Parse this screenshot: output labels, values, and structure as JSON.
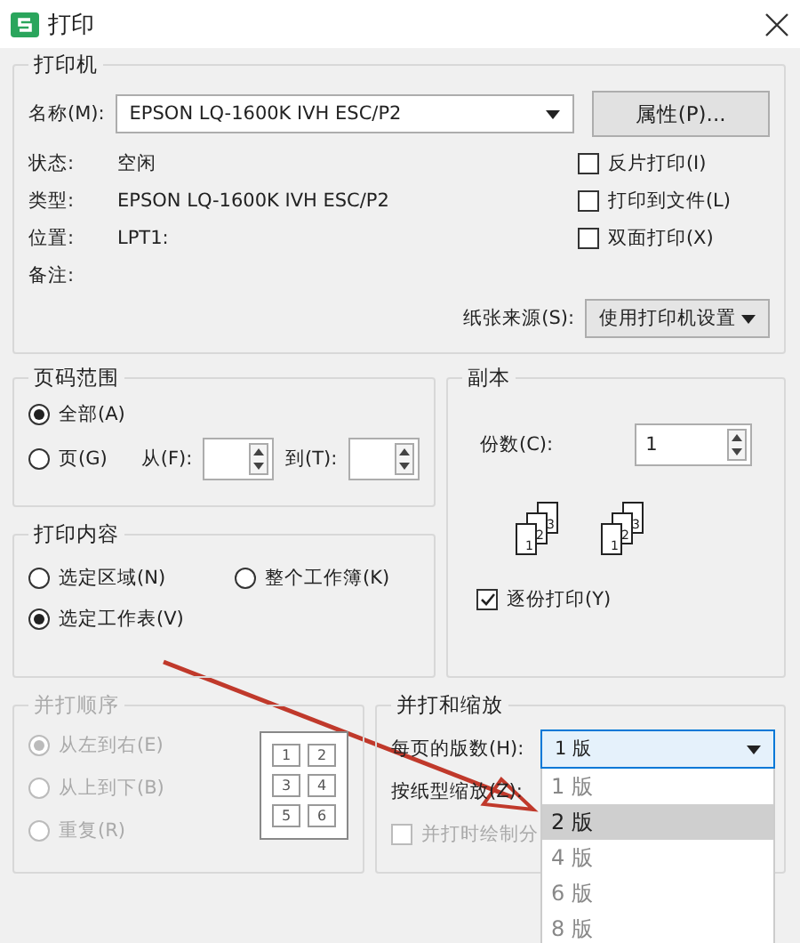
{
  "window": {
    "title": "打印"
  },
  "printer": {
    "title": "打印机",
    "name_label": "名称(M):",
    "name_value": "EPSON LQ-1600K IVH ESC/P2",
    "properties_button": "属性(P)...",
    "info": [
      {
        "label": "状态:",
        "value": "空闲"
      },
      {
        "label": "类型:",
        "value": "EPSON LQ-1600K IVH ESC/P2"
      },
      {
        "label": "位置:",
        "value": "LPT1:"
      },
      {
        "label": "备注:"
      }
    ],
    "options": [
      {
        "label": "反片打印(I)",
        "checked": false
      },
      {
        "label": "打印到文件(L)",
        "checked": false
      },
      {
        "label": "双面打印(X)",
        "checked": false
      }
    ],
    "paper_source_label": "纸张来源(S):",
    "paper_source_value": "使用打印机设置"
  },
  "page_range": {
    "title": "页码范围",
    "options": [
      {
        "label": "全部(A)",
        "selected": true
      },
      {
        "label": "页(G)",
        "selected": false
      }
    ],
    "from_label": "从(F):",
    "to_label": "到(T):"
  },
  "copies": {
    "title": "副本",
    "count_label": "份数(C):",
    "count_value": "1",
    "icons": [
      {
        "page_numbers": [
          "1",
          "2",
          "3"
        ]
      },
      {
        "page_numbers": [
          "1",
          "2",
          "3"
        ]
      }
    ],
    "collate": {
      "label": "逐份打印(Y)",
      "checked": true
    }
  },
  "print_content": {
    "title": "打印内容",
    "options": [
      {
        "label": "选定区域(N)",
        "selected": false
      },
      {
        "label": "整个工作簿(K)",
        "selected": false
      },
      {
        "label": "选定工作表(V)",
        "selected": true
      }
    ]
  },
  "order": {
    "title": "并打顺序",
    "disabled": true,
    "options": [
      {
        "label": "从左到右(E)",
        "selected": true
      },
      {
        "label": "从上到下(B)",
        "selected": false
      },
      {
        "label": "重复(R)",
        "selected": false
      }
    ],
    "grid_numbers": [
      "1",
      "2",
      "3",
      "4",
      "5",
      "6"
    ]
  },
  "scaling": {
    "title": "并打和缩放",
    "pages_per_sheet_label": "每页的版数(H):",
    "pages_per_sheet_value": "1 版",
    "scale_label": "按纸型缩放(Z):",
    "borders": {
      "label": "并打时绘制分",
      "checked": false,
      "disabled": true
    }
  },
  "dropdown_list": [
    {
      "label": "1 版",
      "selected": false
    },
    {
      "label": "2 版",
      "selected": true
    },
    {
      "label": "4 版",
      "selected": false
    },
    {
      "label": "6 版",
      "selected": false
    },
    {
      "label": "8 版",
      "selected": false
    }
  ]
}
